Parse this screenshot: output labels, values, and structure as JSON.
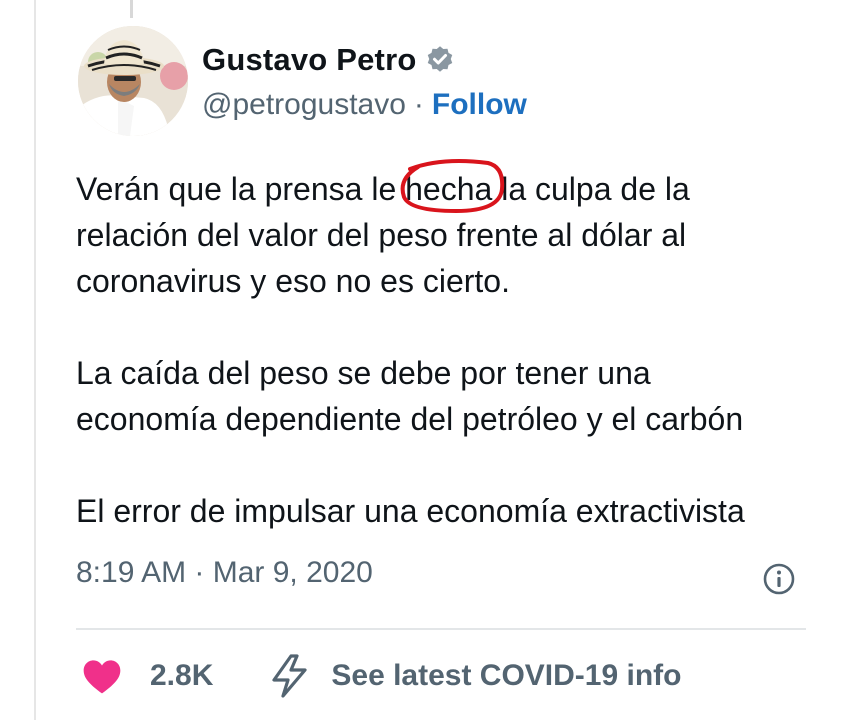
{
  "author": {
    "name": "Gustavo Petro",
    "handle": "@petrogustavo",
    "separator": "·",
    "follow_label": "Follow"
  },
  "tweet": {
    "paragraphs": [
      {
        "lines": [
          {
            "before": "Verán que la prensa le ",
            "circled": "hecha",
            "after": " la culpa de la"
          },
          {
            "text": "relación del valor del peso frente al dólar al"
          },
          {
            "text": "coronavirus y eso no es cierto."
          }
        ]
      },
      {
        "lines": [
          {
            "text": "La caída del peso se debe por tener una"
          },
          {
            "text": "economía dependiente del petróleo y el carbón"
          }
        ]
      },
      {
        "lines": [
          {
            "text": "El error de impulsar una economía extractivista"
          }
        ]
      }
    ],
    "timestamp": "8:19 AM · Mar 9, 2020"
  },
  "actions": {
    "like_count": "2.8K",
    "covid_label": "See latest COVID-19 info"
  },
  "colors": {
    "text": "#0f1419",
    "secondary": "#536471",
    "link": "#1d6fbf",
    "heart": "#f0308a",
    "annotation": "#d9141c",
    "verified": "#8a97a1"
  },
  "icons": [
    "verified-badge-icon",
    "info-icon",
    "heart-icon",
    "lightning-bolt-icon"
  ]
}
